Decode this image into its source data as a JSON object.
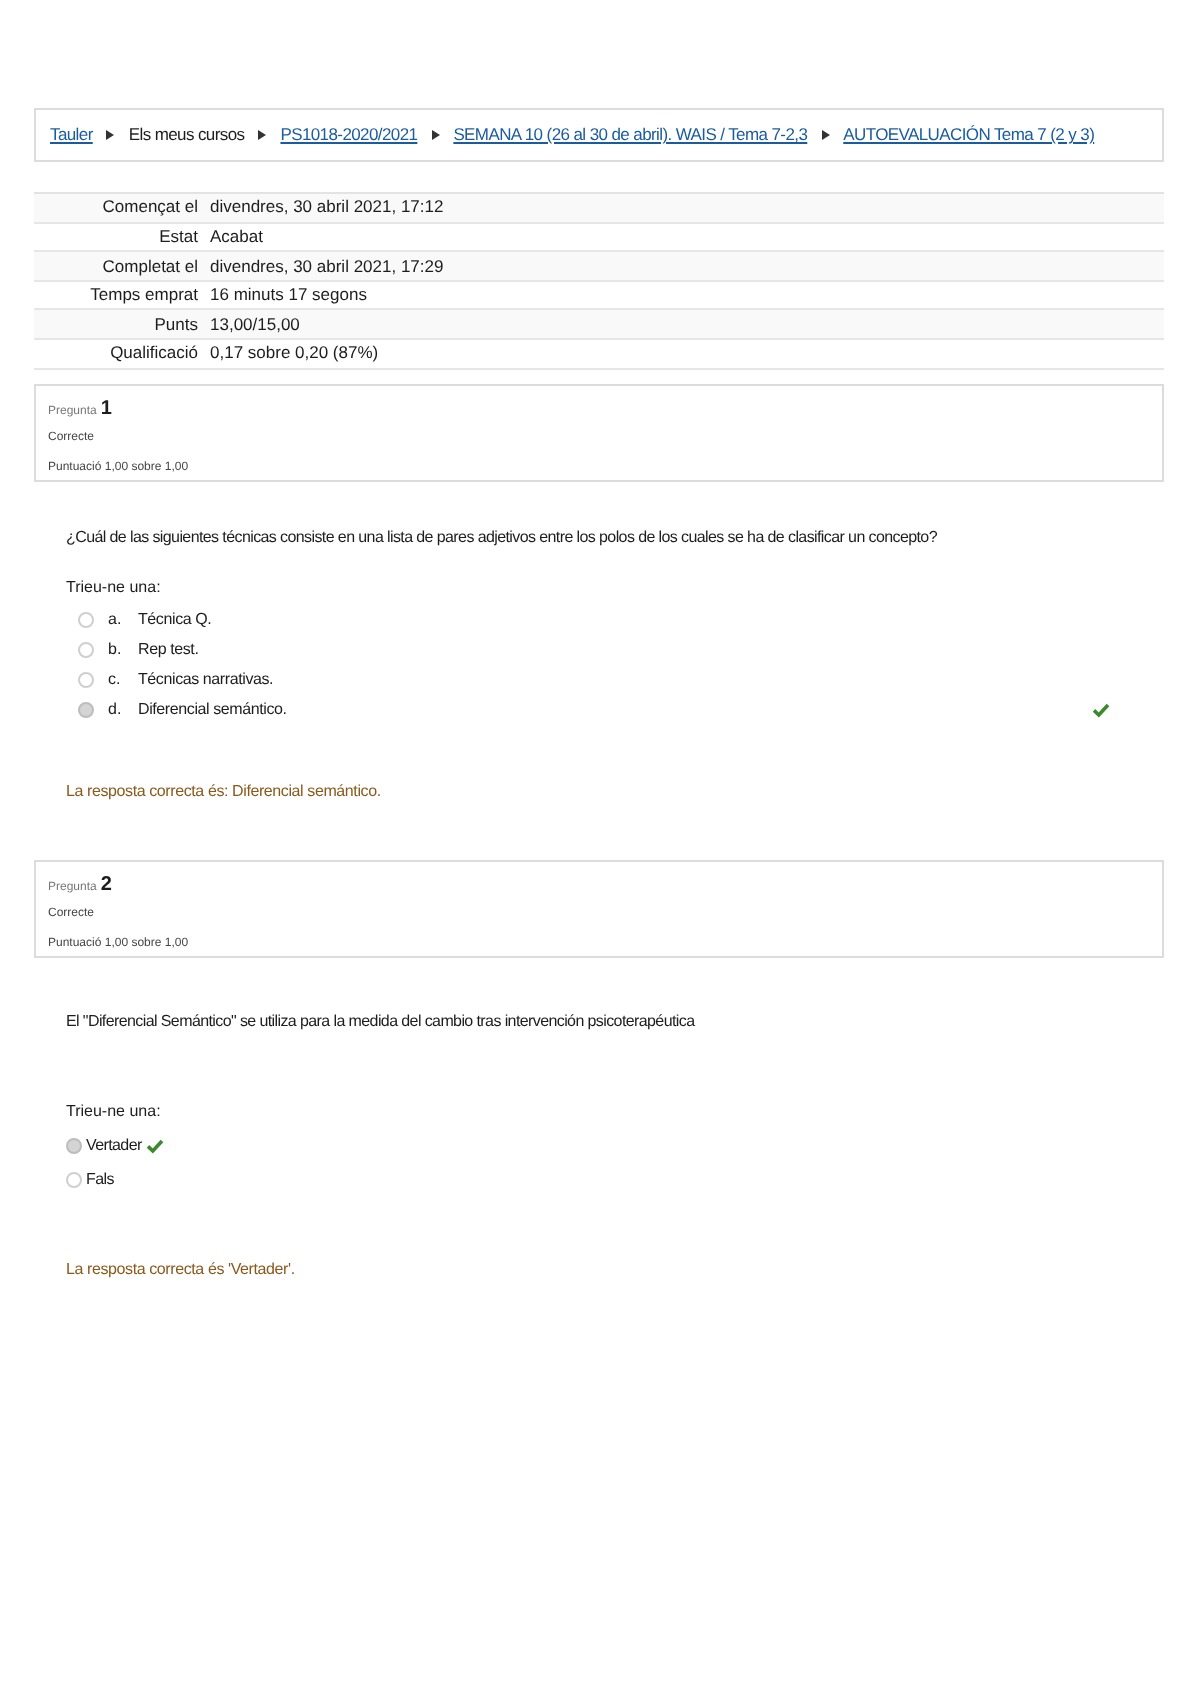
{
  "breadcrumb": [
    {
      "label": "Tauler",
      "kind": "link"
    },
    {
      "label": "Els meus cursos",
      "kind": "text"
    },
    {
      "label": "PS1018-2020/2021",
      "kind": "link"
    },
    {
      "label": "SEMANA 10 (26 al 30 de abril). WAIS / Tema 7-2,3",
      "kind": "link"
    },
    {
      "label": "AUTOEVALUACIÓN Tema 7 (2 y 3)",
      "kind": "link"
    }
  ],
  "summary": [
    {
      "label": "Començat el",
      "value": "divendres, 30 abril 2021, 17:12"
    },
    {
      "label": "Estat",
      "value": "Acabat"
    },
    {
      "label": "Completat el",
      "value": "divendres, 30 abril 2021, 17:29"
    },
    {
      "label": "Temps emprat",
      "value": "16 minuts 17 segons"
    },
    {
      "label": "Punts",
      "value": "13,00/15,00"
    },
    {
      "label": "Qualificació",
      "value": "0,17 sobre 0,20 (87%)"
    }
  ],
  "questions": [
    {
      "label": "Pregunta",
      "number": "1",
      "state": "Correcte",
      "mark": "Puntuació 1,00 sobre 1,00",
      "text": "¿Cuál de las siguientes técnicas consiste en una lista de pares adjetivos entre los polos de los cuales se ha de clasificar un concepto?",
      "prompt": "Trieu-ne una:",
      "kind": "lettered",
      "answers": [
        {
          "letter": "a.",
          "label": "Técnica Q.",
          "selected": false,
          "correct": false
        },
        {
          "letter": "b.",
          "label": "Rep test.",
          "selected": false,
          "correct": false
        },
        {
          "letter": "c.",
          "label": "Técnicas narrativas.",
          "selected": false,
          "correct": false
        },
        {
          "letter": "d.",
          "label": "Diferencial semántico.",
          "selected": true,
          "correct": true
        }
      ],
      "feedback": "La resposta correcta és: Diferencial semántico."
    },
    {
      "label": "Pregunta",
      "number": "2",
      "state": "Correcte",
      "mark": "Puntuació 1,00 sobre 1,00",
      "text": "El \"Diferencial Semántico\" se utiliza para la medida del cambio tras intervención psicoterapéutica",
      "prompt": "Trieu-ne una:",
      "kind": "inline",
      "answers": [
        {
          "label": "Vertader",
          "selected": true,
          "correct": true
        },
        {
          "label": "Fals",
          "selected": false,
          "correct": false
        }
      ],
      "feedback": "La resposta correcta és 'Vertader'."
    }
  ]
}
